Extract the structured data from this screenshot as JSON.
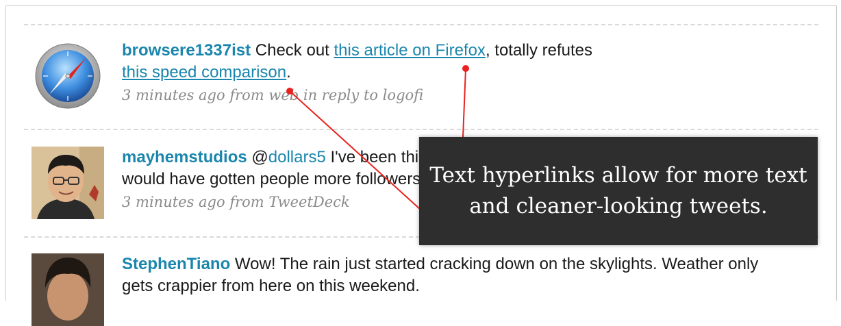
{
  "tweets": [
    {
      "username": "browsere1337ist",
      "text_before": " Check out ",
      "link1": "this article on Firefox",
      "text_mid": ", totally refutes ",
      "link2": "this speed comparison",
      "text_after": ".",
      "meta": "3 minutes ago from web in reply to logofi",
      "avatar_icon": "safari-compass-icon"
    },
    {
      "username": "mayhemstudios",
      "text_before": " @",
      "mention": "dollars5",
      "text_after": " I've been thinking that I should've done #followfriday or I would have gotten people more followers. :)",
      "meta": "3 minutes ago from TweetDeck",
      "avatar_icon": "user-photo"
    },
    {
      "username": "StephenTiano",
      "text_after": " Wow! The rain just started cracking down on the skylights. Weather only gets crappier from here on this weekend.",
      "avatar_icon": "user-photo"
    }
  ],
  "callout": {
    "text": "Text hyperlinks allow for more text and cleaner-looking tweets."
  },
  "colors": {
    "link": "#1a86ad",
    "annotation_line": "#e8231e",
    "callout_bg": "#2e2e2e"
  }
}
